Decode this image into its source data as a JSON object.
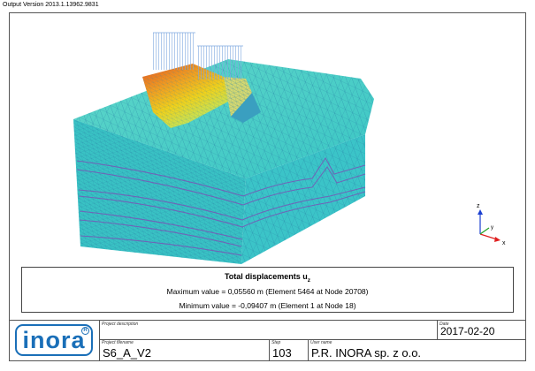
{
  "header": {
    "output_version": "Output Version 2013.1.13962.9831"
  },
  "legend": {
    "title": "Total displacements u",
    "title_sub": "z",
    "max_text": "Maximum value = 0,05560 m (Element 5464 at Node 20708)",
    "min_text": "Minimum value = -0,09407 m (Element 1 at Node 18)"
  },
  "axes": {
    "z": "z",
    "y": "y",
    "x": "x"
  },
  "titleblock": {
    "logo_text": "inora",
    "logo_reg": "R",
    "project_description_label": "Project description",
    "project_filename_label": "Project filename",
    "project_filename": "S6_A_V2",
    "step_label": "Step",
    "step": "103",
    "user_name_label": "User name",
    "user_name": "P.R. INORA sp. z o.o.",
    "date_label": "Date",
    "date": "2017-02-20"
  },
  "colors": {
    "mesh_face": "#3ac6c6",
    "mesh_line": "#2a7fa5",
    "hot": "#e8541e",
    "warm": "#f2c21a",
    "load": "#8fb8e8",
    "logo_blue": "#1a6fb8"
  }
}
